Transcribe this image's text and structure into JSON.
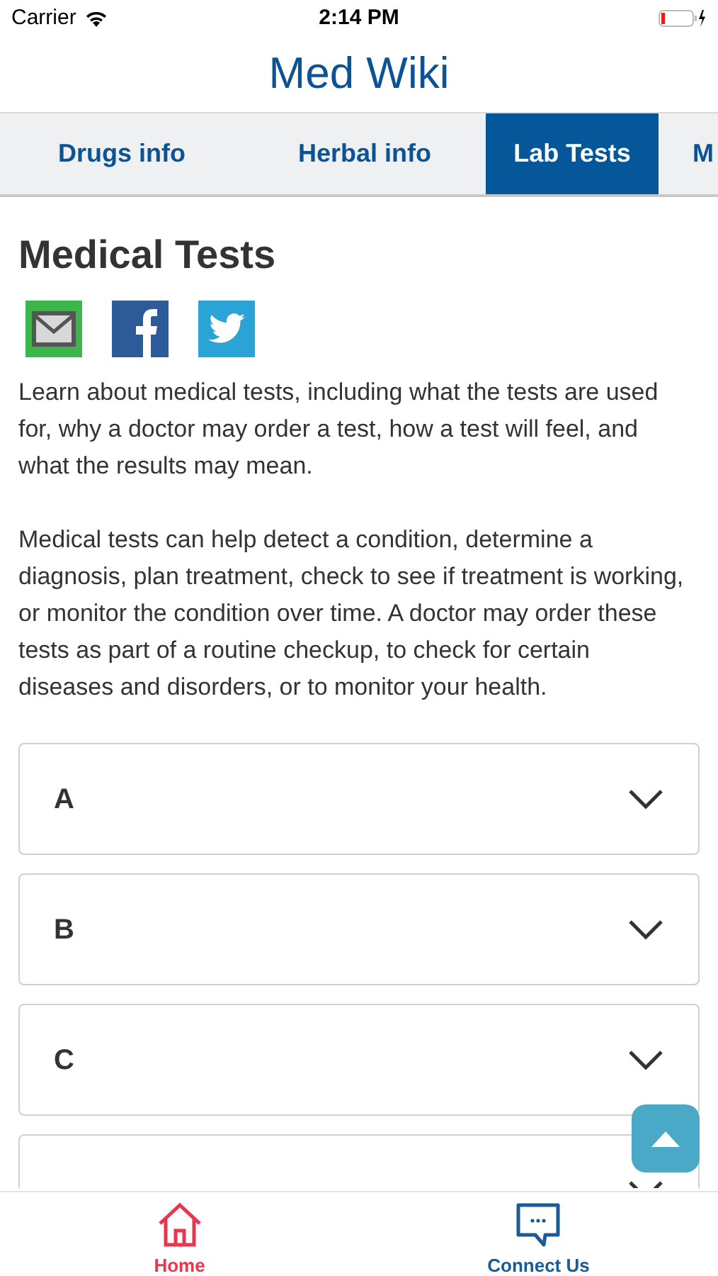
{
  "status_bar": {
    "carrier": "Carrier",
    "time": "2:14 PM"
  },
  "app_title": "Med Wiki",
  "tabs": [
    {
      "label": "Drugs info",
      "selected": false
    },
    {
      "label": "Herbal info",
      "selected": false
    },
    {
      "label": "Lab Tests",
      "selected": true
    },
    {
      "label": "M",
      "selected": false
    }
  ],
  "page_title": "Medical Tests",
  "share": [
    {
      "kind": "email"
    },
    {
      "kind": "facebook"
    },
    {
      "kind": "twitter"
    }
  ],
  "paragraphs": [
    "Learn about medical tests, including what the tests are used for, why a doctor may order a test, how a test will feel, and what the results may mean.",
    "Medical tests can help detect a condition, determine a diagnosis, plan treatment, check to see if treatment is working, or monitor the condition over time. A doctor may order these tests as part of a routine checkup, to check for certain diseases and disorders, or to monitor your health."
  ],
  "sections": [
    {
      "label": "A",
      "expanded": false
    },
    {
      "label": "B",
      "expanded": false
    },
    {
      "label": "C",
      "expanded": false
    },
    {
      "expanded": false
    }
  ],
  "bottom_nav": [
    {
      "label": "Home",
      "kind": "home",
      "selected": true
    },
    {
      "label": "Connect Us",
      "kind": "chat",
      "selected": false
    }
  ]
}
